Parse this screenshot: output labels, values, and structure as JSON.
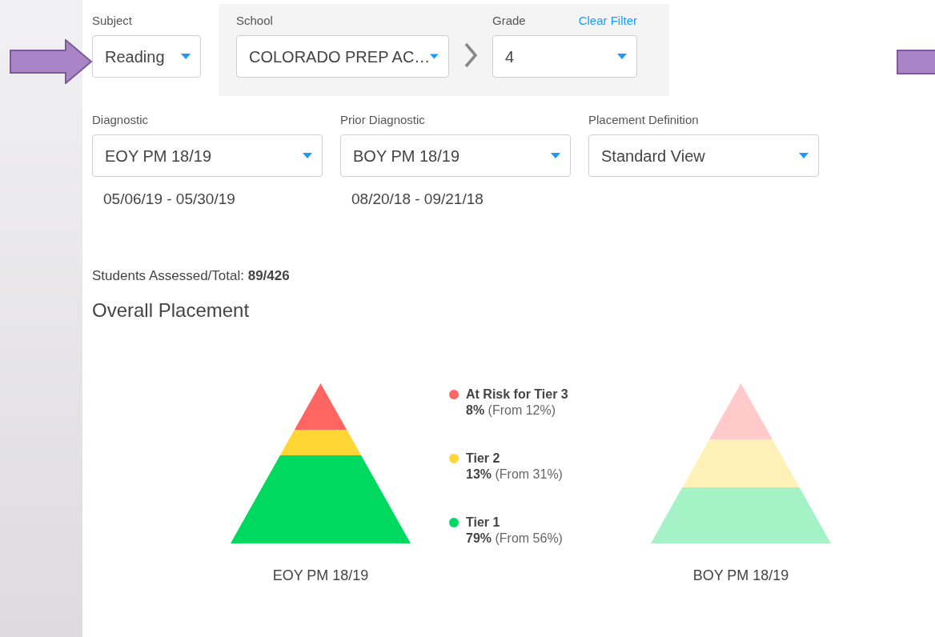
{
  "subject": {
    "label": "Subject",
    "value": "Reading"
  },
  "school_filters": [
    {
      "label": "School",
      "value": "COLORADO PREP AC…"
    },
    {
      "label": "Grade",
      "value": "4"
    }
  ],
  "clear_filter": "Clear Filter",
  "diagnostics": [
    {
      "label": "Diagnostic",
      "value": "EOY PM 18/19",
      "dates": "05/06/19 - 05/30/19"
    },
    {
      "label": "Prior Diagnostic",
      "value": "BOY PM 18/19",
      "dates": "08/20/18 - 09/21/18"
    },
    {
      "label": "Placement Definition",
      "value": "Standard View"
    }
  ],
  "students_assessed": "Students Assessed/Total: **89/426**",
  "overall_placement": {
    "title": "Overall Placement",
    "pyramids": [
      {
        "caption": "EOY PM 18/19",
        "faded": false
      },
      {
        "caption": "BOY PM 18/19",
        "faded": true
      }
    ],
    "legend": [
      {
        "name": "At Risk for Tier 3",
        "color": "#ff6663",
        "share": "**8%** (From 12%)"
      },
      {
        "name": "Tier 2",
        "color": "#ffd633",
        "share": "**13%** (From 31%)"
      },
      {
        "name": "Tier 1",
        "color": "#00d95f",
        "share": "**79%** (From 56%)"
      }
    ]
  }
}
